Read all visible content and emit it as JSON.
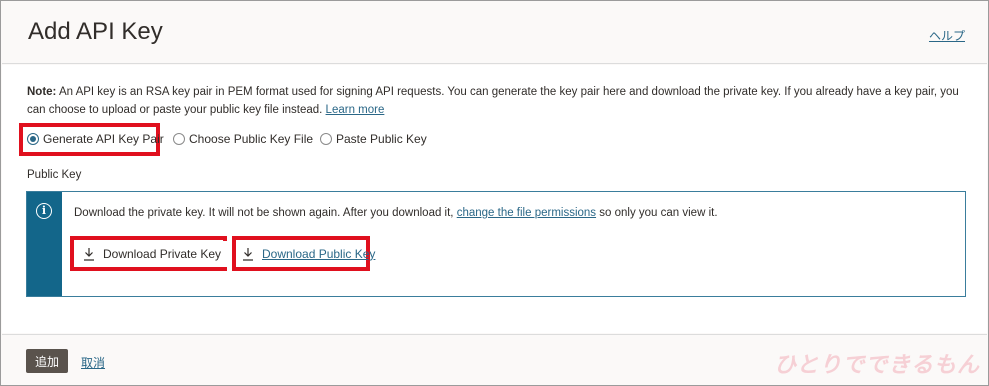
{
  "dialog": {
    "title": "Add API Key",
    "help_label": "ヘルプ"
  },
  "note": {
    "label": "Note:",
    "text": " An API key is an RSA key pair in PEM format used for signing API requests. You can generate the key pair here and download the private key. If you already have a key pair, you can choose to upload or paste your public key file instead. ",
    "learn_more": "Learn more"
  },
  "options": {
    "items": [
      {
        "label": "Generate API Key Pair",
        "checked": true
      },
      {
        "label": "Choose Public Key File",
        "checked": false
      },
      {
        "label": "Paste Public Key",
        "checked": false
      }
    ]
  },
  "public_key": {
    "section_label": "Public Key",
    "info_before": "Download the private key. It will not be shown again. After you download it, ",
    "info_link": "change the file permissions",
    "info_after": " so only you can view it.",
    "download_private": "Download Private Key",
    "download_public": "Download Public Key"
  },
  "footer": {
    "add_label": "追加",
    "cancel_label": "取消"
  },
  "watermark": {
    "text": "ひとりでできるもん"
  },
  "colors": {
    "accent": "#2a6787",
    "info_strip": "#13668a",
    "highlight": "#e0101e",
    "primary_button": "#5a534d"
  },
  "icons": {
    "info": "info-icon",
    "download": "download-icon"
  }
}
